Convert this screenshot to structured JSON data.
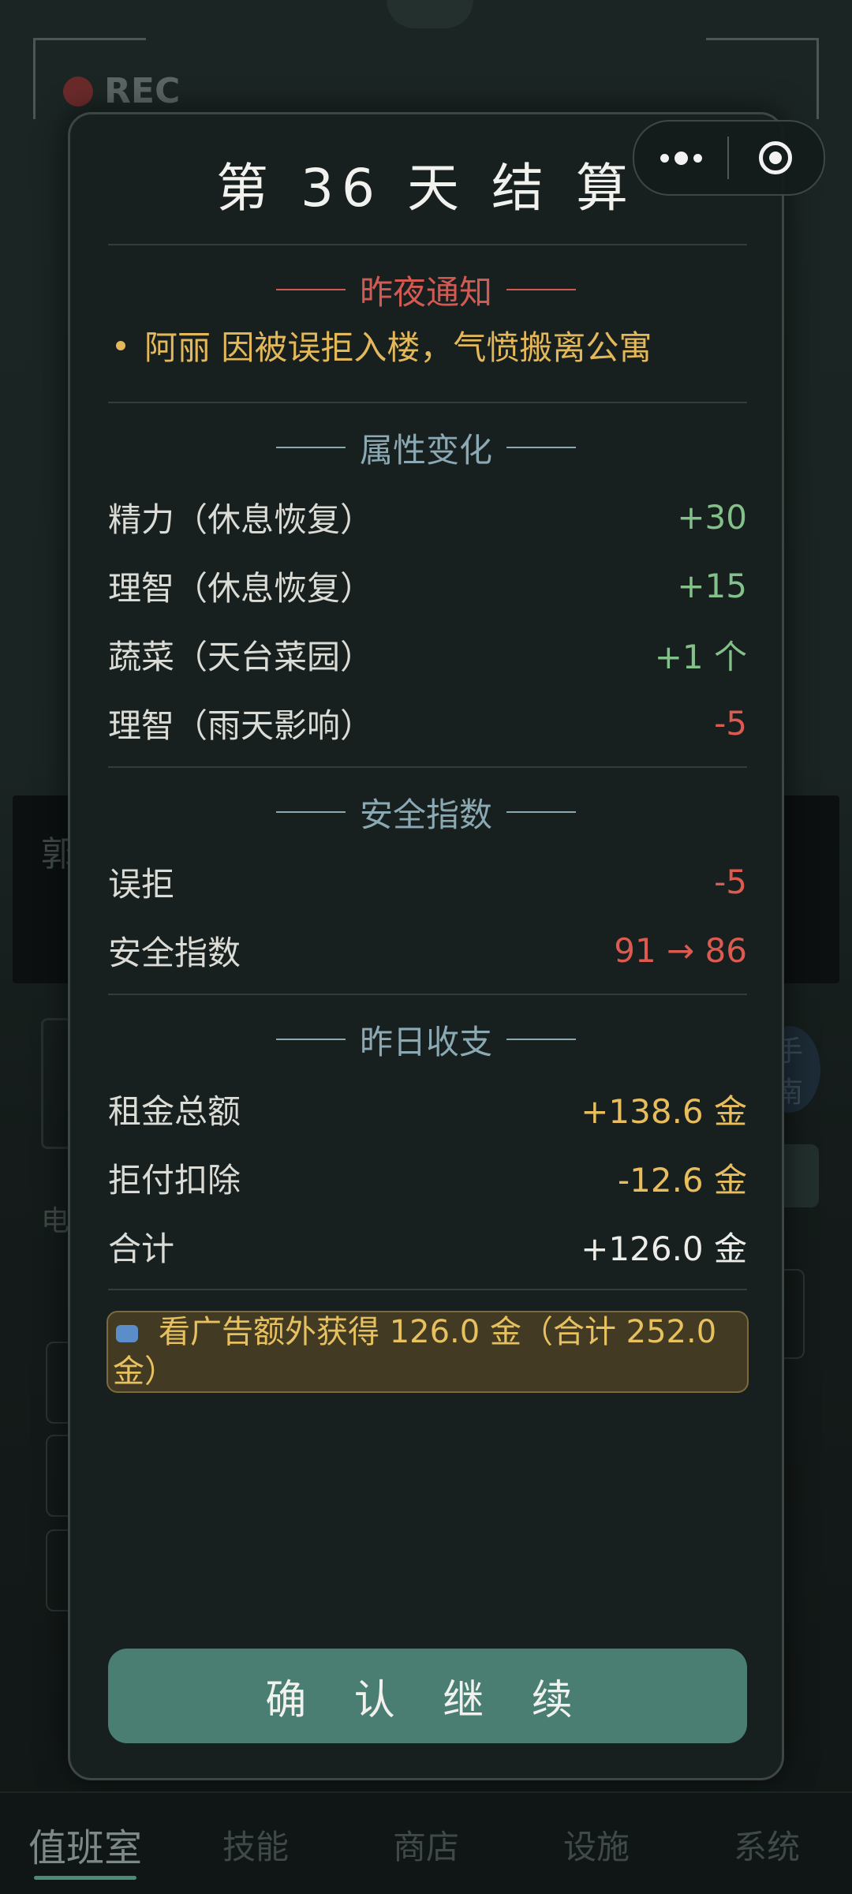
{
  "background": {
    "rec_label": "REC",
    "left_partial_text": "郭",
    "right_chip_top": "手",
    "right_chip_bottom": "南",
    "left_partial_small": "电"
  },
  "capsule": {
    "more_icon": "more-dots-icon",
    "close_icon": "close-target-icon"
  },
  "modal": {
    "title": "第 36 天 结 算",
    "notice_section": {
      "heading": "昨夜通知",
      "items": [
        "阿丽 因被误拒入楼，气愤搬离公寓"
      ]
    },
    "attr_section": {
      "heading": "属性变化",
      "rows": [
        {
          "label": "精力（休息恢复）",
          "value": "+30",
          "tone": "green"
        },
        {
          "label": "理智（休息恢复）",
          "value": "+15",
          "tone": "green"
        },
        {
          "label": "蔬菜（天台菜园）",
          "value": "+1 个",
          "tone": "green"
        },
        {
          "label": "理智（雨天影响）",
          "value": "-5",
          "tone": "red"
        }
      ]
    },
    "safety_section": {
      "heading": "安全指数",
      "rows": [
        {
          "label": "误拒",
          "value": "-5",
          "tone": "red"
        },
        {
          "label": "安全指数",
          "value": "91 → 86",
          "tone": "red"
        }
      ]
    },
    "finance_section": {
      "heading": "昨日收支",
      "rows": [
        {
          "label": "租金总额",
          "value": "+138.6 金",
          "tone": "gold"
        },
        {
          "label": "拒付扣除",
          "value": "-12.6 金",
          "tone": "gold"
        },
        {
          "label": "合计",
          "value": "+126.0 金",
          "tone": "white"
        }
      ]
    },
    "ad_offer": {
      "icon": "video-ad-icon",
      "text": "看广告额外获得 126.0 金（合计 252.0 金）"
    },
    "confirm_label": "确 认 继 续"
  },
  "tabbar": {
    "tabs": [
      {
        "label": "值班室",
        "active": true
      },
      {
        "label": "技能",
        "active": false
      },
      {
        "label": "商店",
        "active": false
      },
      {
        "label": "设施",
        "active": false
      },
      {
        "label": "系统",
        "active": false
      }
    ]
  },
  "colors": {
    "accent_green": "#4a7e72",
    "positive": "#84c08a",
    "negative": "#dc5a50",
    "gold": "#e7bd5e",
    "notice_heading": "#d25a52",
    "section_heading": "#8aa9b3"
  }
}
